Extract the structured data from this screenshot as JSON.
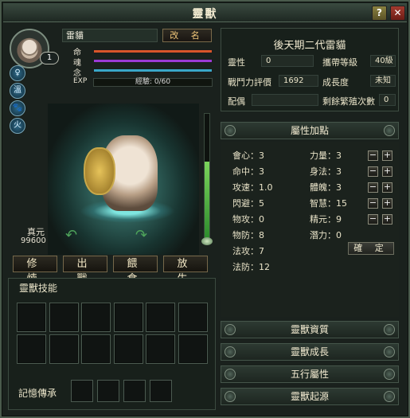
{
  "window": {
    "title": "靈獸"
  },
  "title_buttons": {
    "help": "?",
    "close": "✕"
  },
  "pet": {
    "name": "雷貓",
    "rename_label": "改 名",
    "level": "1",
    "stats": [
      {
        "label": "命",
        "color": "#d9552a"
      },
      {
        "label": "魂",
        "color": "#9b3bd6"
      },
      {
        "label": "念",
        "color": "#39a7c8"
      }
    ],
    "exp_label": "EXP",
    "exp_text": "經驗: 0/60",
    "exp_fraction": 0,
    "side_icons": [
      "♀",
      "溫",
      "🐾",
      "火"
    ],
    "zhenyuan_label": "真元",
    "zhenyuan_value": "99600",
    "vertical_meter_fraction": 0.62
  },
  "actions": [
    "修 煉",
    "出 戰",
    "餵 食",
    "放 生"
  ],
  "skills": {
    "title": "靈獸技能",
    "memory_label": "記憶傳承"
  },
  "info": {
    "title": "後天期二代雷貓",
    "rows": [
      {
        "label": "靈性",
        "value": "0"
      },
      {
        "label": "攜帶等級",
        "value": "40級"
      },
      {
        "label": "戰鬥力評價",
        "value": "1692"
      },
      {
        "label": "成長度",
        "value": "未知"
      },
      {
        "label": "配偶",
        "value": ""
      },
      {
        "label": "剩餘繁殖次數",
        "value": "0"
      }
    ]
  },
  "attributes": {
    "header": "屬性加點",
    "left": [
      {
        "label": "會心",
        "value": "3"
      },
      {
        "label": "命中",
        "value": "3"
      },
      {
        "label": "攻速",
        "value": "1.0"
      },
      {
        "label": "閃避",
        "value": "5"
      },
      {
        "label": "物攻",
        "value": "0"
      },
      {
        "label": "物防",
        "value": "8"
      },
      {
        "label": "法攻",
        "value": "7"
      },
      {
        "label": "法防",
        "value": "12"
      }
    ],
    "right": [
      {
        "label": "力量",
        "value": "3"
      },
      {
        "label": "身法",
        "value": "3"
      },
      {
        "label": "體魄",
        "value": "3"
      },
      {
        "label": "智慧",
        "value": "15"
      },
      {
        "label": "精元",
        "value": "9"
      },
      {
        "label": "潛力",
        "value": "0"
      }
    ],
    "minus": "−",
    "plus": "+",
    "confirm_label": "確 定"
  },
  "sections": [
    "靈獸資質",
    "靈獸成長",
    "五行屬性",
    "靈獸起源"
  ]
}
